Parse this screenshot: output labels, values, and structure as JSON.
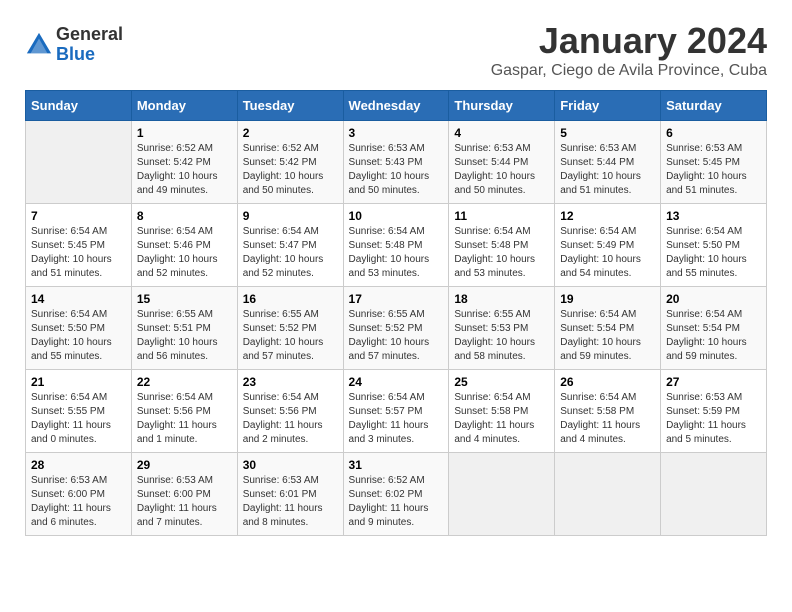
{
  "logo": {
    "general": "General",
    "blue": "Blue"
  },
  "title": "January 2024",
  "subtitle": "Gaspar, Ciego de Avila Province, Cuba",
  "headers": [
    "Sunday",
    "Monday",
    "Tuesday",
    "Wednesday",
    "Thursday",
    "Friday",
    "Saturday"
  ],
  "weeks": [
    [
      {
        "day": "",
        "sunrise": "",
        "sunset": "",
        "daylight": ""
      },
      {
        "day": "1",
        "sunrise": "Sunrise: 6:52 AM",
        "sunset": "Sunset: 5:42 PM",
        "daylight": "Daylight: 10 hours and 49 minutes."
      },
      {
        "day": "2",
        "sunrise": "Sunrise: 6:52 AM",
        "sunset": "Sunset: 5:42 PM",
        "daylight": "Daylight: 10 hours and 50 minutes."
      },
      {
        "day": "3",
        "sunrise": "Sunrise: 6:53 AM",
        "sunset": "Sunset: 5:43 PM",
        "daylight": "Daylight: 10 hours and 50 minutes."
      },
      {
        "day": "4",
        "sunrise": "Sunrise: 6:53 AM",
        "sunset": "Sunset: 5:44 PM",
        "daylight": "Daylight: 10 hours and 50 minutes."
      },
      {
        "day": "5",
        "sunrise": "Sunrise: 6:53 AM",
        "sunset": "Sunset: 5:44 PM",
        "daylight": "Daylight: 10 hours and 51 minutes."
      },
      {
        "day": "6",
        "sunrise": "Sunrise: 6:53 AM",
        "sunset": "Sunset: 5:45 PM",
        "daylight": "Daylight: 10 hours and 51 minutes."
      }
    ],
    [
      {
        "day": "7",
        "sunrise": "Sunrise: 6:54 AM",
        "sunset": "Sunset: 5:45 PM",
        "daylight": "Daylight: 10 hours and 51 minutes."
      },
      {
        "day": "8",
        "sunrise": "Sunrise: 6:54 AM",
        "sunset": "Sunset: 5:46 PM",
        "daylight": "Daylight: 10 hours and 52 minutes."
      },
      {
        "day": "9",
        "sunrise": "Sunrise: 6:54 AM",
        "sunset": "Sunset: 5:47 PM",
        "daylight": "Daylight: 10 hours and 52 minutes."
      },
      {
        "day": "10",
        "sunrise": "Sunrise: 6:54 AM",
        "sunset": "Sunset: 5:48 PM",
        "daylight": "Daylight: 10 hours and 53 minutes."
      },
      {
        "day": "11",
        "sunrise": "Sunrise: 6:54 AM",
        "sunset": "Sunset: 5:48 PM",
        "daylight": "Daylight: 10 hours and 53 minutes."
      },
      {
        "day": "12",
        "sunrise": "Sunrise: 6:54 AM",
        "sunset": "Sunset: 5:49 PM",
        "daylight": "Daylight: 10 hours and 54 minutes."
      },
      {
        "day": "13",
        "sunrise": "Sunrise: 6:54 AM",
        "sunset": "Sunset: 5:50 PM",
        "daylight": "Daylight: 10 hours and 55 minutes."
      }
    ],
    [
      {
        "day": "14",
        "sunrise": "Sunrise: 6:54 AM",
        "sunset": "Sunset: 5:50 PM",
        "daylight": "Daylight: 10 hours and 55 minutes."
      },
      {
        "day": "15",
        "sunrise": "Sunrise: 6:55 AM",
        "sunset": "Sunset: 5:51 PM",
        "daylight": "Daylight: 10 hours and 56 minutes."
      },
      {
        "day": "16",
        "sunrise": "Sunrise: 6:55 AM",
        "sunset": "Sunset: 5:52 PM",
        "daylight": "Daylight: 10 hours and 57 minutes."
      },
      {
        "day": "17",
        "sunrise": "Sunrise: 6:55 AM",
        "sunset": "Sunset: 5:52 PM",
        "daylight": "Daylight: 10 hours and 57 minutes."
      },
      {
        "day": "18",
        "sunrise": "Sunrise: 6:55 AM",
        "sunset": "Sunset: 5:53 PM",
        "daylight": "Daylight: 10 hours and 58 minutes."
      },
      {
        "day": "19",
        "sunrise": "Sunrise: 6:54 AM",
        "sunset": "Sunset: 5:54 PM",
        "daylight": "Daylight: 10 hours and 59 minutes."
      },
      {
        "day": "20",
        "sunrise": "Sunrise: 6:54 AM",
        "sunset": "Sunset: 5:54 PM",
        "daylight": "Daylight: 10 hours and 59 minutes."
      }
    ],
    [
      {
        "day": "21",
        "sunrise": "Sunrise: 6:54 AM",
        "sunset": "Sunset: 5:55 PM",
        "daylight": "Daylight: 11 hours and 0 minutes."
      },
      {
        "day": "22",
        "sunrise": "Sunrise: 6:54 AM",
        "sunset": "Sunset: 5:56 PM",
        "daylight": "Daylight: 11 hours and 1 minute."
      },
      {
        "day": "23",
        "sunrise": "Sunrise: 6:54 AM",
        "sunset": "Sunset: 5:56 PM",
        "daylight": "Daylight: 11 hours and 2 minutes."
      },
      {
        "day": "24",
        "sunrise": "Sunrise: 6:54 AM",
        "sunset": "Sunset: 5:57 PM",
        "daylight": "Daylight: 11 hours and 3 minutes."
      },
      {
        "day": "25",
        "sunrise": "Sunrise: 6:54 AM",
        "sunset": "Sunset: 5:58 PM",
        "daylight": "Daylight: 11 hours and 4 minutes."
      },
      {
        "day": "26",
        "sunrise": "Sunrise: 6:54 AM",
        "sunset": "Sunset: 5:58 PM",
        "daylight": "Daylight: 11 hours and 4 minutes."
      },
      {
        "day": "27",
        "sunrise": "Sunrise: 6:53 AM",
        "sunset": "Sunset: 5:59 PM",
        "daylight": "Daylight: 11 hours and 5 minutes."
      }
    ],
    [
      {
        "day": "28",
        "sunrise": "Sunrise: 6:53 AM",
        "sunset": "Sunset: 6:00 PM",
        "daylight": "Daylight: 11 hours and 6 minutes."
      },
      {
        "day": "29",
        "sunrise": "Sunrise: 6:53 AM",
        "sunset": "Sunset: 6:00 PM",
        "daylight": "Daylight: 11 hours and 7 minutes."
      },
      {
        "day": "30",
        "sunrise": "Sunrise: 6:53 AM",
        "sunset": "Sunset: 6:01 PM",
        "daylight": "Daylight: 11 hours and 8 minutes."
      },
      {
        "day": "31",
        "sunrise": "Sunrise: 6:52 AM",
        "sunset": "Sunset: 6:02 PM",
        "daylight": "Daylight: 11 hours and 9 minutes."
      },
      {
        "day": "",
        "sunrise": "",
        "sunset": "",
        "daylight": ""
      },
      {
        "day": "",
        "sunrise": "",
        "sunset": "",
        "daylight": ""
      },
      {
        "day": "",
        "sunrise": "",
        "sunset": "",
        "daylight": ""
      }
    ]
  ]
}
